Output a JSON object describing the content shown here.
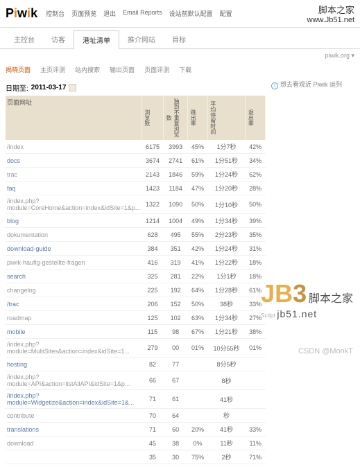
{
  "logo": {
    "text": "Piwik"
  },
  "topnav": [
    "控制台",
    "页面预览",
    "退出",
    "Email Reports",
    "设站前默认配置",
    "配置"
  ],
  "watermark_top": {
    "cn": "脚本之家",
    "url": "www.Jb51.net"
  },
  "tabs": [
    "主控台",
    "访客",
    "港址清单",
    "推介网站",
    "目标"
  ],
  "active_tab": 2,
  "secondary": {
    "site": "piwik.org",
    "dd": "▾"
  },
  "subtabs": [
    "揭晓页面",
    "主页评测",
    "站内搜索",
    "输出页面",
    "页面评测",
    "下载"
  ],
  "active_subtab": 0,
  "date": {
    "label": "日期至:",
    "value": "2011-03-17"
  },
  "right_msg": "想去看观近 Piwik 运列",
  "columns": [
    "页面网址",
    "浏览数",
    "独到不重复浏览数",
    "跳出率",
    "平均停留时间",
    "退出率"
  ],
  "rows": [
    [
      "/index",
      "6175",
      "3993",
      "45%",
      "1分7秒",
      "42%"
    ],
    [
      "docs",
      "3674",
      "2741",
      "61%",
      "1分51秒",
      "34%"
    ],
    [
      "trac",
      "2143",
      "1846",
      "59%",
      "1分24秒",
      "62%"
    ],
    [
      "faq",
      "1423",
      "1184",
      "47%",
      "1分20秒",
      "28%"
    ],
    [
      "/index.php?module=CoreHome&action=index&idSite=1&p...",
      "1322",
      "1090",
      "50%",
      "1分10秒",
      "50%"
    ],
    [
      "blog",
      "1214",
      "1004",
      "49%",
      "1分34秒",
      "39%"
    ],
    [
      "dokumentation",
      "628",
      "495",
      "55%",
      "2分23秒",
      "35%"
    ],
    [
      "download-guide",
      "384",
      "351",
      "42%",
      "1分24秒",
      "31%"
    ],
    [
      "piwik-haufig-gestellte-fragen",
      "416",
      "319",
      "41%",
      "1分22秒",
      "18%"
    ],
    [
      "search",
      "325",
      "281",
      "22%",
      "1分1秒",
      "18%"
    ],
    [
      "changelog",
      "225",
      "192",
      "64%",
      "1分28秒",
      "61%"
    ],
    [
      "/trac",
      "206",
      "152",
      "50%",
      "38秒",
      "33%"
    ],
    [
      "roadmap",
      "125",
      "102",
      "63%",
      "1分34秒",
      "27%"
    ],
    [
      "mobile",
      "115",
      "98",
      "67%",
      "1分21秒",
      "38%"
    ],
    [
      "/index.php?module=MultiSites&action=index&idSite=1...",
      "279",
      "00",
      "01%",
      "10分55秒",
      "01%"
    ],
    [
      "hosting",
      "82",
      "77",
      "",
      "8分5秒",
      ""
    ],
    [
      "/index.php?module=API&action=listAllAPI&idSite=1&p...",
      "66",
      "67",
      "",
      "8秒",
      ""
    ],
    [
      "/index.php?module=Widgetize&action=index&idSite=1&...",
      "71",
      "61",
      "",
      "41秒",
      ""
    ],
    [
      "contribute",
      "70",
      "64",
      "",
      "秒",
      ""
    ],
    [
      "translations",
      "71",
      "60",
      "20%",
      "41秒",
      "33%"
    ],
    [
      "download",
      "45",
      "38",
      "0%",
      "11秒",
      "11%"
    ],
    [
      "",
      "35",
      "30",
      "75%",
      "2秒",
      "71%"
    ]
  ],
  "wm": {
    "jb": "JB",
    "three": "3",
    "script": "Script",
    "cn": "脚本之家",
    "url": "jb51.net"
  },
  "wm2": "CSDN @MonkT"
}
